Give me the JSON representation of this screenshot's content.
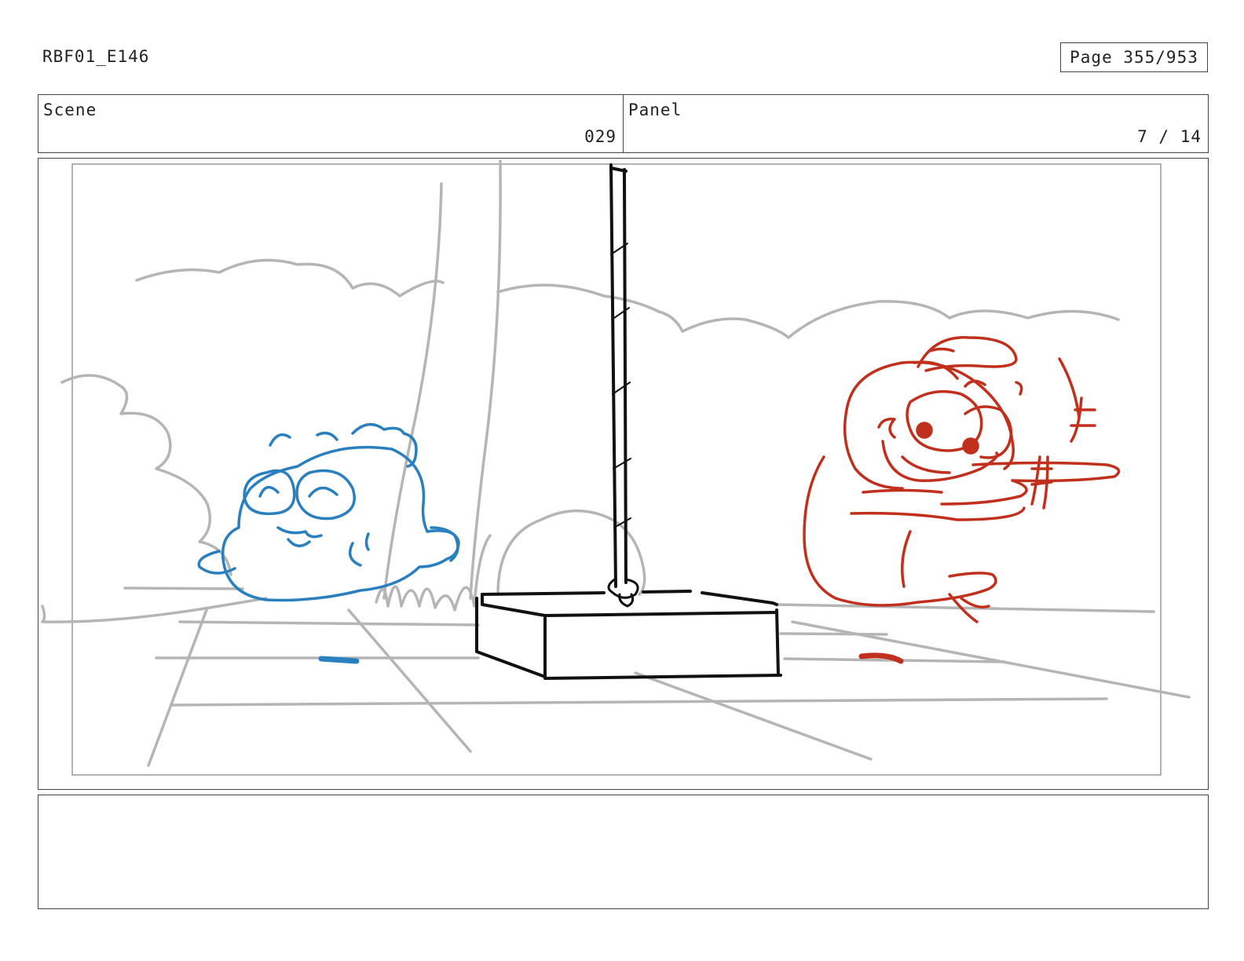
{
  "header": {
    "doc_id": "RBF01_E146",
    "page_label": "Page 355/953"
  },
  "info": {
    "scene_label": "Scene",
    "scene_value": "029",
    "panel_label": "Panel",
    "panel_value": "7 / 14"
  },
  "colors": {
    "background_sketch": "#b5b5b5",
    "blue_character": "#2a7fbf",
    "red_character": "#c0301c",
    "ink": "#111111"
  },
  "notes": {
    "text": ""
  }
}
